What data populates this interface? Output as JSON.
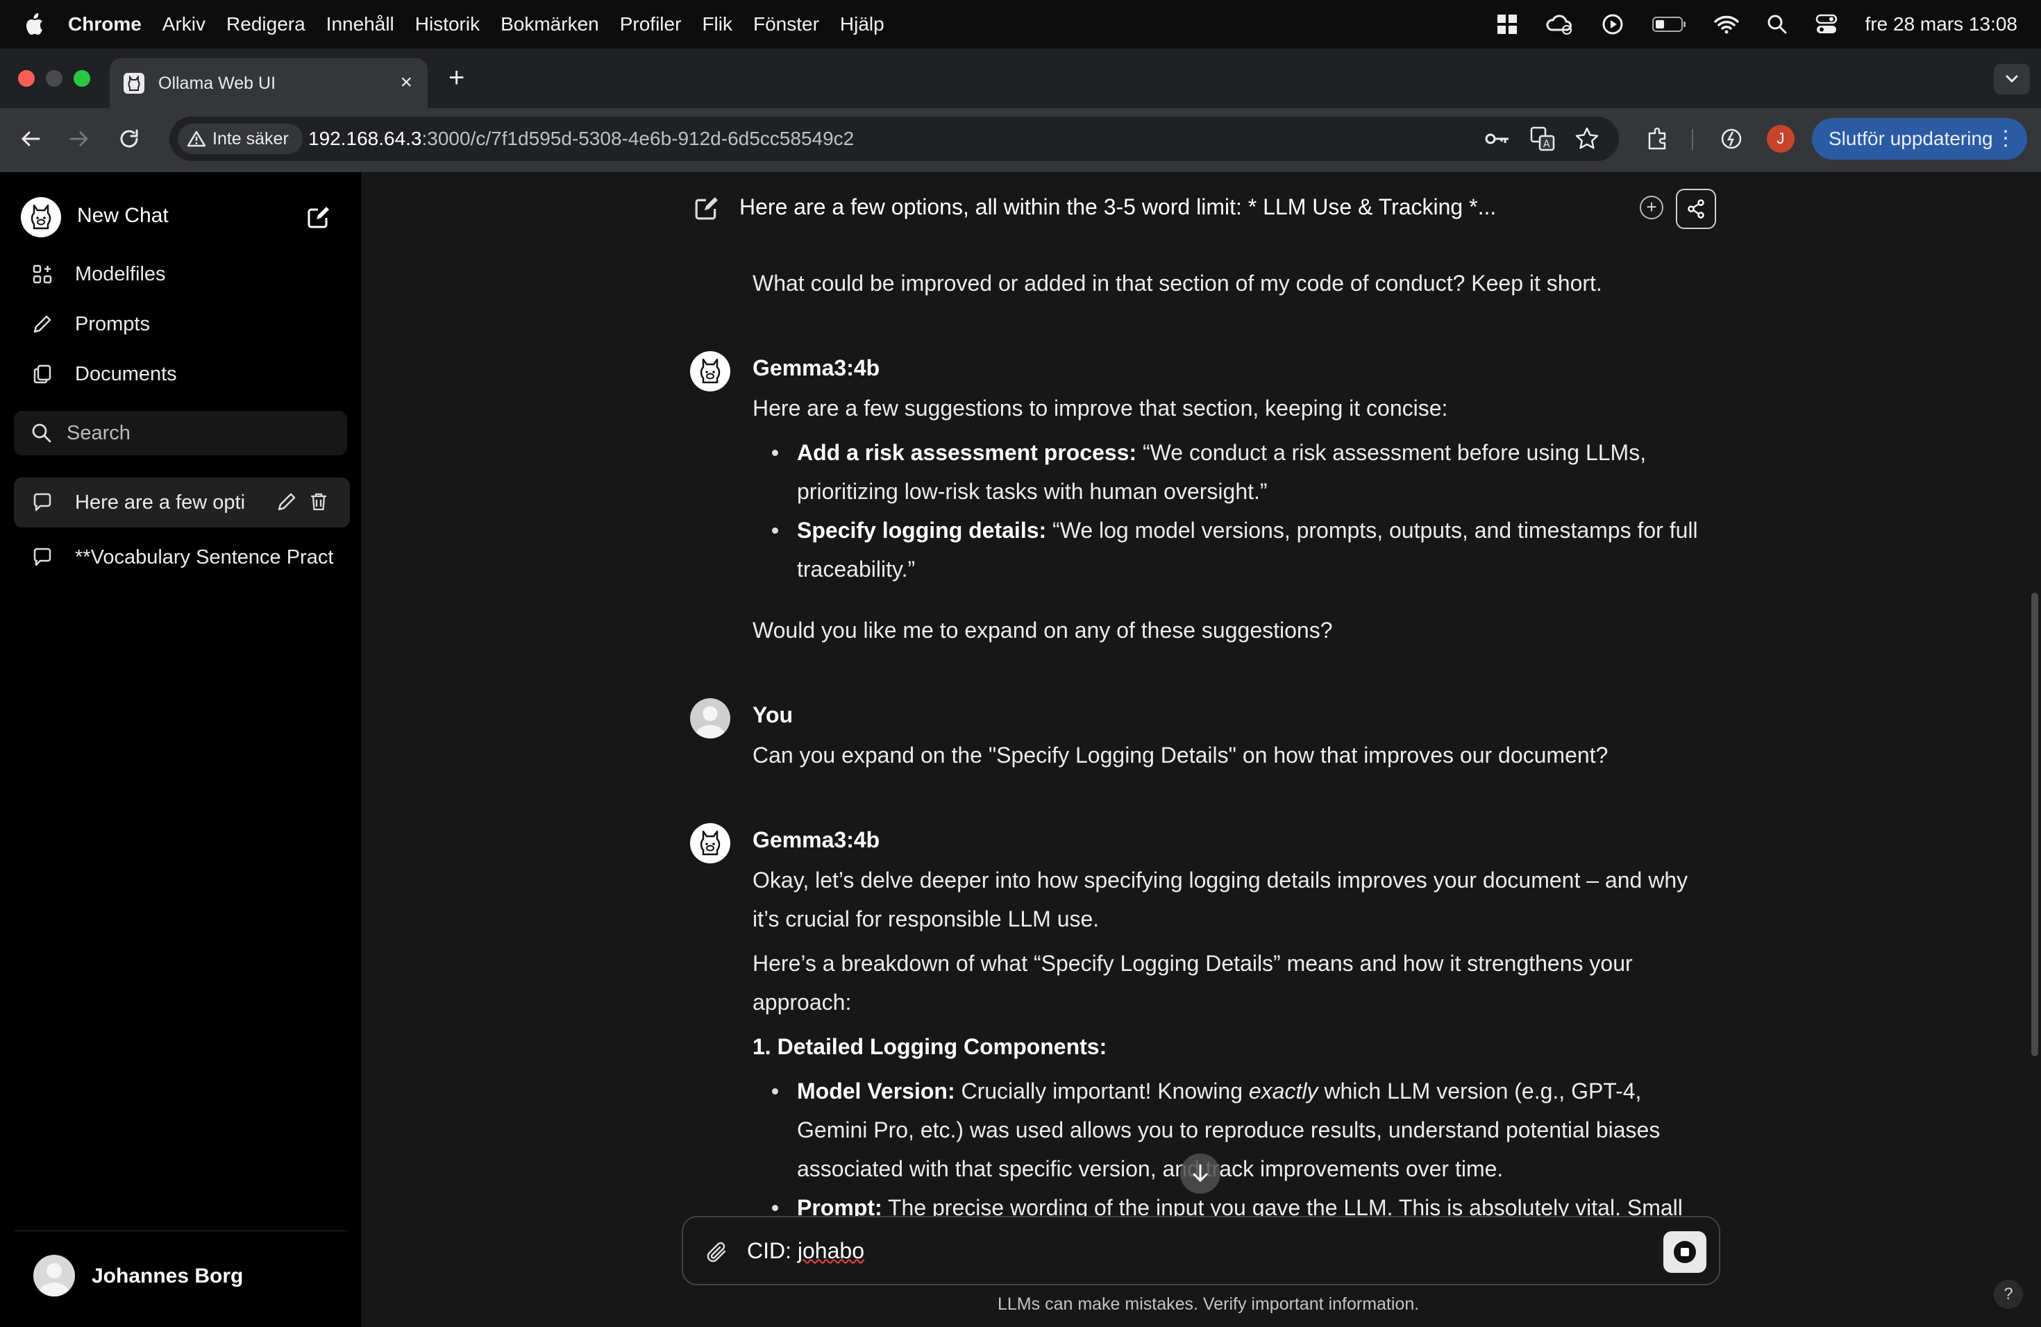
{
  "menubar": {
    "app": "Chrome",
    "items": [
      "Arkiv",
      "Redigera",
      "Innehåll",
      "Historik",
      "Bokmärken",
      "Profiler",
      "Flik",
      "Fönster",
      "Hjälp"
    ],
    "datetime": "fre 28 mars 13:08"
  },
  "browser": {
    "tab_title": "Ollama Web UI",
    "security_label": "Inte säker",
    "url_host": "192.168.64.3",
    "url_rest": ":3000/c/7f1d595d-5308-4e6b-912d-6d5cc58549c2",
    "update_button": "Slutför uppdatering",
    "profile_initial": "J"
  },
  "sidebar": {
    "new_chat": "New Chat",
    "nav": [
      {
        "label": "Modelfiles",
        "icon": "grid-icon"
      },
      {
        "label": "Prompts",
        "icon": "pencil-icon"
      },
      {
        "label": "Documents",
        "icon": "documents-icon"
      }
    ],
    "search_placeholder": "Search",
    "chats": [
      {
        "title": "Here are a few opti",
        "active": true
      },
      {
        "title": "**Vocabulary Sentence Pract",
        "active": false
      }
    ],
    "user_name": "Johannes Borg"
  },
  "chat": {
    "title": "Here are a few options, all within the 3-5 word limit: * LLM Use & Tracking *...",
    "messages": {
      "m0_text": "What could be improved or added in that section of my code of conduct? Keep it short.",
      "m1_name": "Gemma3:4b",
      "m1_intro": "Here are a few suggestions to improve that section, keeping it concise:",
      "m1_b1_bold": "Add a risk assessment process:",
      "m1_b1_l1": "“We conduct a risk assessment before using LLMs,",
      "m1_b1_l2": "prioritizing low-risk tasks with human oversight.”",
      "m1_b2_bold": "Specify logging details:",
      "m1_b2_l1": "“We log model versions, prompts, outputs, and timestamps for full",
      "m1_b2_l2": "traceability.”",
      "m1_outro": "Would you like me to expand on any of these suggestions?",
      "m2_name": "You",
      "m2_text": "Can you expand on the \"Specify Logging Details\" on how that improves our document?",
      "m3_name": "Gemma3:4b",
      "m3_p1_l1": "Okay, let’s delve deeper into how specifying logging details improves your document – and why",
      "m3_p1_l2": "it’s crucial for responsible LLM use.",
      "m3_p2_l1": "Here’s a breakdown of what “Specify Logging Details” means and how it strengthens your",
      "m3_p2_l2": "approach:",
      "m3_heading": "1. Detailed Logging Components:",
      "m3_b1_bold": "Model Version:",
      "m3_b1_a": "Crucially important! Knowing",
      "m3_b1_em": "exactly",
      "m3_b1_b": "which LLM version (e.g., GPT-4,",
      "m3_b1_l2": "Gemini Pro, etc.) was used allows you to reproduce results, understand potential biases",
      "m3_b1_l3": "associated with that specific version, and track improvements over time.",
      "m3_b2_bold": "Prompt:",
      "m3_b2_l1": "The precise wording of the input you gave the LLM. This is absolutely vital. Small"
    },
    "input_prefix": "CID: ",
    "input_word": "johabo",
    "disclaimer": "LLMs can make mistakes. Verify important information.",
    "help": "?"
  },
  "colors": {
    "background": "#171717",
    "sidebar": "#000000",
    "accent_update": "#2a5ba3"
  }
}
